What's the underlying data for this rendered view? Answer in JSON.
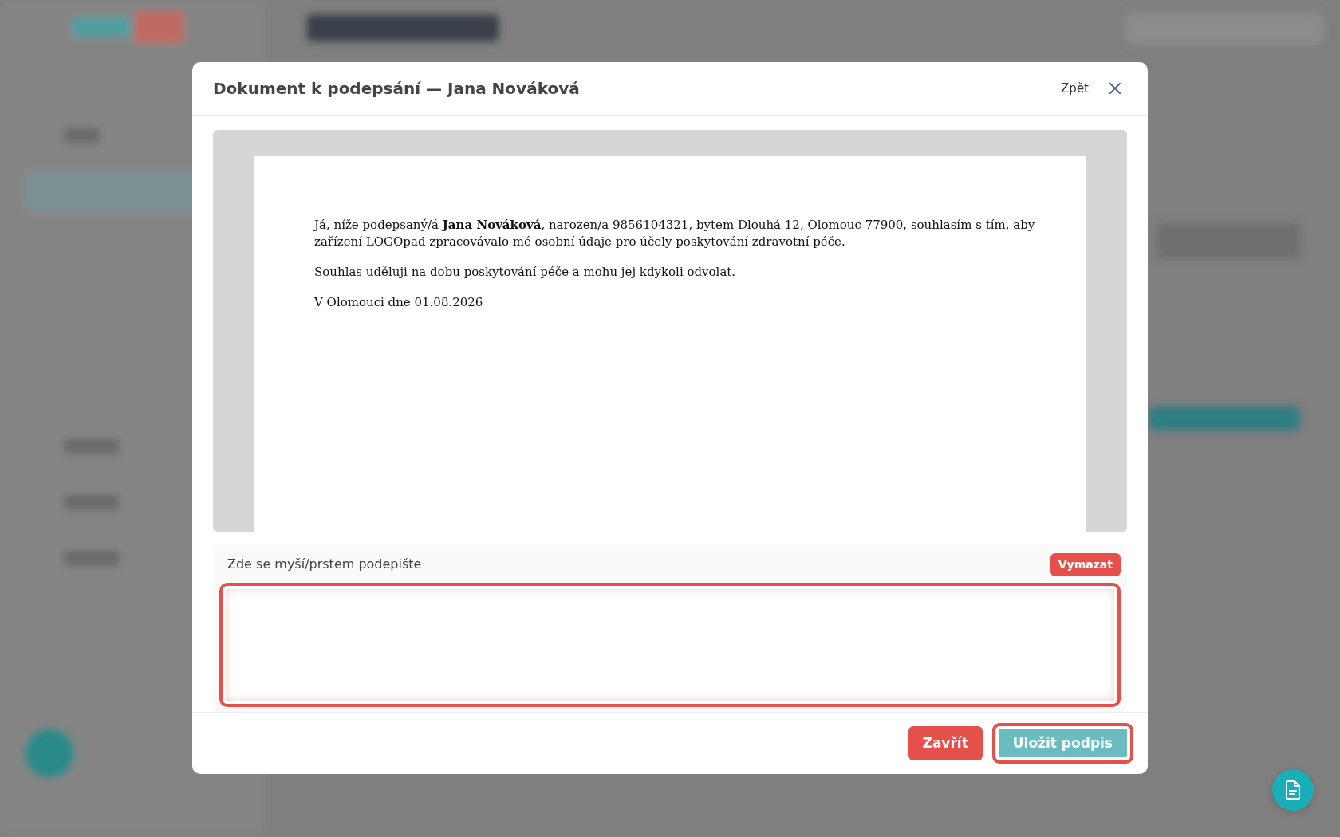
{
  "modal": {
    "title": "Dokument k podepsání — Jana Nováková",
    "back_link": "Zpět",
    "document": {
      "paragraphs": [
        "Já, níže podepsaný/á **Jana Nováková**, narozen/a 9856104321, bytem Dlouhá 12, Olomouc 77900, souhlasím s tím, aby zařízení LOGOpad zpracovávalo mé osobní údaje pro účely poskytování zdravotní péče.",
        "Souhlas uděluji na dobu poskytování péče a mohu jej kdykoli odvolat.",
        "V Olomouci dne 01.08.2026"
      ]
    },
    "signature": {
      "label": "Zde se myší/prstem podepište",
      "clear_button": "Vymazat",
      "highlighted": true
    },
    "buttons": [
      {
        "label": "Zavřít",
        "kind": "danger"
      },
      {
        "label": "Uložit podpis",
        "kind": "primary",
        "highlighted": true
      }
    ]
  }
}
